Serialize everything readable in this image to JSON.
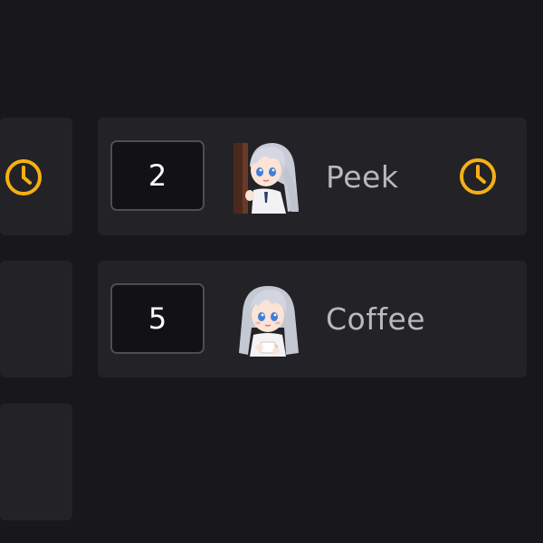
{
  "colors": {
    "background": "#18181b",
    "card": "#232327",
    "accent_clock": "#f5b014",
    "text_primary": "#ffffff",
    "text_secondary": "#b8b8bd"
  },
  "sticker_rows": [
    {
      "count": "2",
      "name": "Peek",
      "avatar": "anime-girl-peeking-avatar",
      "pending_icon": "clock-icon"
    },
    {
      "count": "5",
      "name": "Coffee",
      "avatar": "anime-girl-coffee-avatar",
      "pending_icon": null
    }
  ],
  "left_column": {
    "first_card_icon": "clock-icon"
  }
}
